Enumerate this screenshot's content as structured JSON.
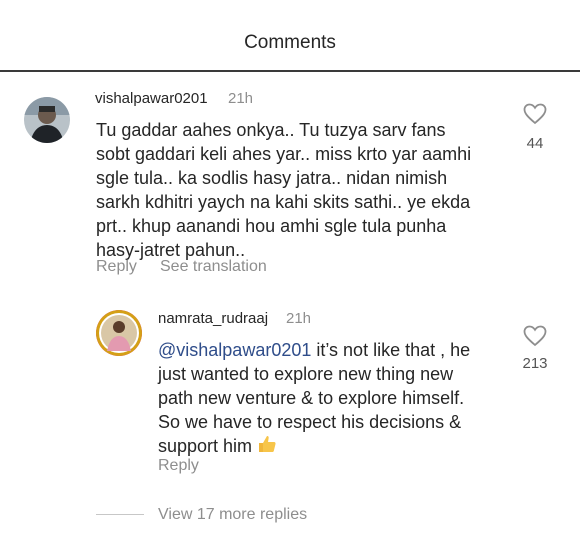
{
  "header": {
    "title": "Comments"
  },
  "comments": [
    {
      "username": "vishalpawar0201",
      "time": "21h",
      "text": "Tu gaddar aahes onkya.. Tu tuzya sarv fans\nsobt gaddari keli ahes yar.. miss krto yar aamhi\nsgle tula.. ka sodlis hasy jatra.. nidan nimish\nsarkh kdhitri yaych na kahi skits sathi.. ye ekda\nprt.. khup aanandi hou amhi sgle tula punha\nhasy-jatret pahun..",
      "likes": "44",
      "reply_label": "Reply",
      "translate_label": "See translation"
    }
  ],
  "reply": {
    "username": "namrata_rudraaj",
    "time": "21h",
    "mention": "@vishalpawar0201",
    "text": " it’s not like that , he\njust wanted to explore new thing new\npath new venture & to explore himself.\nSo we have to respect his decisions &\nsupport him ",
    "emoji": "thumbs-up",
    "likes": "213",
    "reply_label": "Reply"
  },
  "view_more": {
    "label": "View 17 more replies"
  },
  "colors": {
    "mention": "#2f4d8a",
    "muted": "#8e8e8e",
    "text": "#262626"
  }
}
